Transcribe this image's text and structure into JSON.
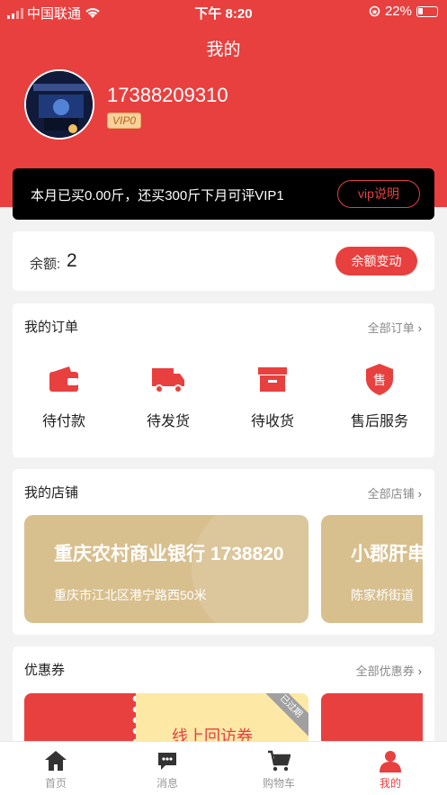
{
  "status_bar": {
    "carrier": "中国联通",
    "time": "下午 8:20",
    "battery": "22%"
  },
  "header": {
    "title": "我的"
  },
  "profile": {
    "phone": "17388209310",
    "vip_level": "VIP0"
  },
  "vip_bar": {
    "text": "本月已买0.00斤，还买300斤下月可评VIP1",
    "button": "vip说明"
  },
  "balance": {
    "label": "余额:",
    "value": "2",
    "button": "余额变动"
  },
  "orders": {
    "title": "我的订单",
    "more": "全部订单",
    "items": [
      {
        "label": "待付款",
        "icon": "wallet-icon"
      },
      {
        "label": "待发货",
        "icon": "truck-icon"
      },
      {
        "label": "待收货",
        "icon": "box-icon"
      },
      {
        "label": "售后服务",
        "icon": "shield-icon",
        "icon_text": "售"
      }
    ]
  },
  "stores": {
    "title": "我的店铺",
    "more": "全部店铺",
    "items": [
      {
        "name": "重庆农村商业银行  1738820",
        "address": "重庆市江北区港宁路西50米"
      },
      {
        "name": "小郡肝串",
        "address": "陈家桥街道"
      }
    ]
  },
  "coupons": {
    "title": "优惠券",
    "more": "全部优惠券",
    "items": [
      {
        "title": "线上回访券",
        "tag": "已过期"
      }
    ]
  },
  "tabbar": {
    "items": [
      {
        "label": "首页",
        "icon": "home-icon"
      },
      {
        "label": "消息",
        "icon": "message-icon"
      },
      {
        "label": "购物车",
        "icon": "cart-icon"
      },
      {
        "label": "我的",
        "icon": "user-icon",
        "active": true
      }
    ]
  },
  "colors": {
    "brand_red": "#e8403f",
    "store_gold": "#d8bf8e",
    "coupon_yellow": "#fde8a6"
  }
}
